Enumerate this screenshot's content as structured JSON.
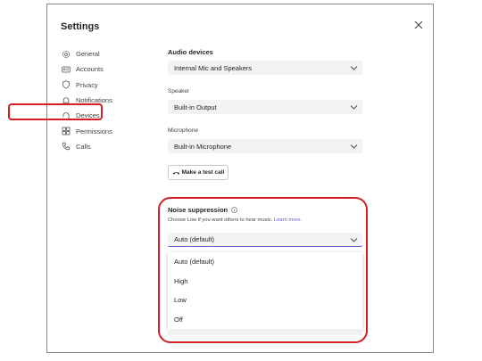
{
  "dialog": {
    "title": "Settings"
  },
  "nav": {
    "items": [
      {
        "label": "General",
        "icon": "gear-icon"
      },
      {
        "label": "Accounts",
        "icon": "id-card-icon"
      },
      {
        "label": "Privacy",
        "icon": "shield-icon"
      },
      {
        "label": "Notifications",
        "icon": "bell-icon"
      },
      {
        "label": "Devices",
        "icon": "headset-icon"
      },
      {
        "label": "Permissions",
        "icon": "grid-icon"
      },
      {
        "label": "Calls",
        "icon": "phone-icon"
      }
    ],
    "selected": "Devices"
  },
  "audio": {
    "title": "Audio devices",
    "device_value": "Internal Mic and Speakers",
    "speaker_label": "Speaker",
    "speaker_value": "Built-in Output",
    "microphone_label": "Microphone",
    "microphone_value": "Built-in Microphone",
    "test_call_label": "Make a test call"
  },
  "noise": {
    "title": "Noise suppression",
    "hint": "Choose Low if you want others to hear music.",
    "link": "Learn more.",
    "value": "Auto (default)",
    "options": [
      "Auto (default)",
      "High",
      "Low",
      "Off"
    ]
  },
  "colors": {
    "accent": "#5b5fc7",
    "annotation": "#d41f24",
    "field_bg": "#f3f3f3"
  }
}
